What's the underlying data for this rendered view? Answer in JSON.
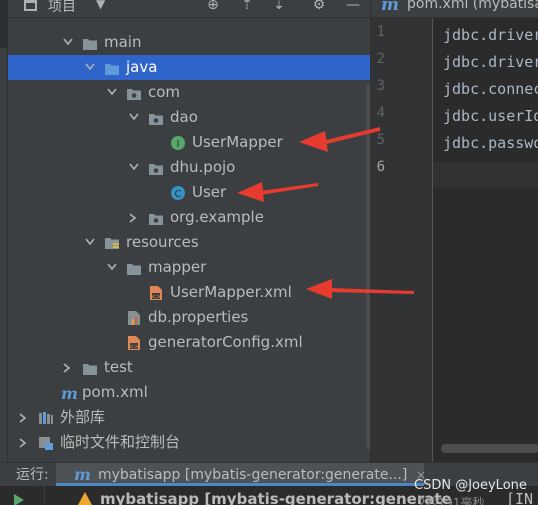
{
  "project_panel": {
    "title": "项目",
    "tree": [
      {
        "label": "main",
        "type": "folder",
        "expanded": true
      },
      {
        "label": "java",
        "type": "source-folder",
        "expanded": true,
        "selected": true
      },
      {
        "label": "com",
        "type": "package",
        "expanded": true
      },
      {
        "label": "dao",
        "type": "package",
        "expanded": true
      },
      {
        "label": "UserMapper",
        "type": "interface"
      },
      {
        "label": "dhu.pojo",
        "type": "package",
        "expanded": true
      },
      {
        "label": "User",
        "type": "class"
      },
      {
        "label": "org.example",
        "type": "package",
        "expanded": false
      },
      {
        "label": "resources",
        "type": "resources-folder",
        "expanded": true
      },
      {
        "label": "mapper",
        "type": "folder",
        "expanded": true
      },
      {
        "label": "UserMapper.xml",
        "type": "xml-file"
      },
      {
        "label": "db.properties",
        "type": "properties-file"
      },
      {
        "label": "generatorConfig.xml",
        "type": "xml-file"
      },
      {
        "label": "test",
        "type": "folder",
        "expanded": false
      },
      {
        "label": "pom.xml",
        "type": "maven-file"
      },
      {
        "label": "外部库",
        "type": "libraries",
        "expanded": false
      },
      {
        "label": "临时文件和控制台",
        "type": "scratches",
        "expanded": false
      }
    ]
  },
  "editor": {
    "tab_label": "pom.xml (mybatisapp)",
    "line_numbers": [
      "1",
      "2",
      "3",
      "4",
      "5",
      "6"
    ],
    "current_line": "6",
    "code_lines": [
      "jdbc.driver",
      "jdbc.driver",
      "jdbc.connection",
      "jdbc.userId",
      "jdbc.password",
      ""
    ]
  },
  "run_bar": {
    "label": "运行:",
    "tab_label": "mybatisapp [mybatis-generator:generate...]",
    "close_glyph": "×"
  },
  "console": {
    "message": "mybatisapp [mybatis-generator:generate",
    "time": "2秒191毫秒",
    "output": "[IN"
  },
  "watermark": "CSDN @JoeyLone",
  "colors": {
    "selection": "#2f65ca",
    "folder": "#87939a",
    "interface": "#59a869",
    "class": "#3592c4",
    "arrow": "#e63b2e"
  }
}
